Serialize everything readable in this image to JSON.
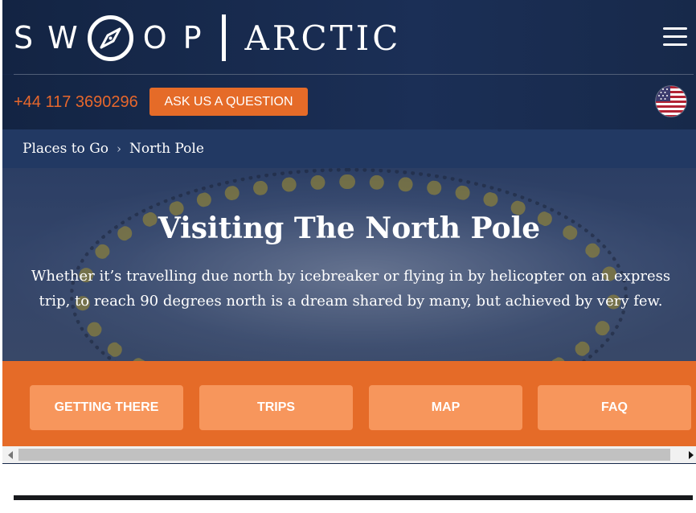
{
  "header": {
    "brand": "SWOOP",
    "brand_letters": [
      "S",
      "W",
      "O",
      "P"
    ],
    "divider": "|",
    "product": "ARCTIC",
    "menu_icon": "hamburger-icon"
  },
  "contact": {
    "phone": "+44 117 3690296",
    "ask_button": "ASK US A QUESTION",
    "flag_icon": "us-flag-icon"
  },
  "breadcrumbs": [
    {
      "label": "Places to Go"
    },
    {
      "label": "North Pole"
    }
  ],
  "breadcrumb_separator": "›",
  "hero": {
    "title": "Visiting The North Pole",
    "description": "Whether it’s travelling due north by icebreaker or flying in by helicopter on an express trip, to reach 90 degrees north is a dream shared by many, but achieved by very few."
  },
  "tabs": [
    {
      "label": "GETTING THERE"
    },
    {
      "label": "TRIPS"
    },
    {
      "label": "MAP"
    },
    {
      "label": "FAQ"
    }
  ],
  "colors": {
    "navy": "#16284a",
    "orange": "#e56b28",
    "tab_orange": "#f7965c"
  }
}
